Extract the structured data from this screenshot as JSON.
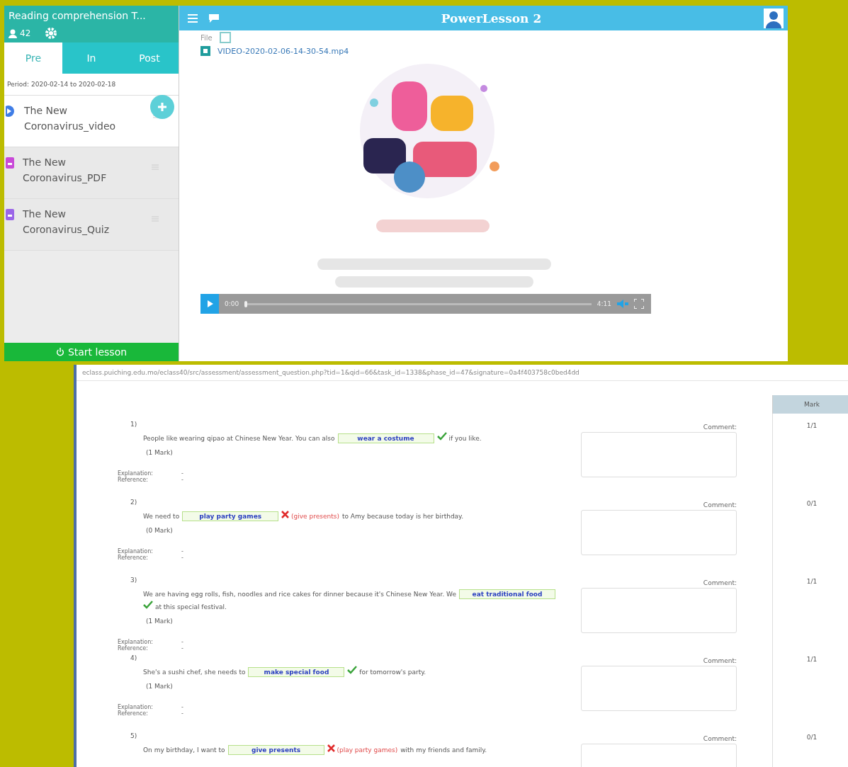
{
  "lesson_app": {
    "sidebar": {
      "title": "Reading comprehension T...",
      "students": "42",
      "tabs": [
        {
          "label": "Pre",
          "selected": true
        },
        {
          "label": "In",
          "selected": false
        },
        {
          "label": "Post",
          "selected": false
        }
      ],
      "period": "Period: 2020-02-14 to 2020-02-18",
      "items": [
        {
          "kind": "video",
          "title": "The New Coronavirus_video",
          "selected": true
        },
        {
          "kind": "pdf",
          "title": "The New Coronavirus_PDF",
          "selected": false
        },
        {
          "kind": "quiz",
          "title": "The New Coronavirus_Quiz",
          "selected": false
        }
      ],
      "start_button": "Start lesson"
    },
    "header": {
      "title": "PowerLesson 2"
    },
    "file_label": "File",
    "file_name": "VIDEO-2020-02-06-14-30-54.mp4",
    "player": {
      "current_time": "0:00",
      "duration": "4:11",
      "level": 0.0
    }
  },
  "assessment": {
    "url": "eclass.puiching.edu.mo/eclass40/src/assessment/assessment_question.php?tid=1&qid=66&task_id=1338&phase_id=47&signature=0a4f403758c0bed4dd",
    "mark_header": "Mark",
    "questions": [
      {
        "number": "1)",
        "before": "People like wearing qipao at Chinese New Year. You can also",
        "answer": "wear a costume",
        "correct": true,
        "after": "if you like.",
        "marks": "(1 Mark)",
        "explanation_label": "Explanation:",
        "explanation": "-",
        "reference_label": "Reference:",
        "reference": "-",
        "comment_label": "Comment:",
        "score": "1/1"
      },
      {
        "number": "2)",
        "before": "We need to",
        "answer": "play party games",
        "correct": false,
        "correct_answer": "(give presents)",
        "after": "to Amy because today is her birthday.",
        "marks": "(0 Mark)",
        "explanation_label": "Explanation:",
        "explanation": "-",
        "reference_label": "Reference:",
        "reference": "-",
        "comment_label": "Comment:",
        "score": "0/1"
      },
      {
        "number": "3)",
        "before": "We are having egg rolls, fish, noodles and rice cakes for dinner because it's Chinese New Year. We",
        "answer": "eat traditional food",
        "correct": true,
        "after": "at this special festival.",
        "marks": "(1 Mark)",
        "explanation_label": "Explanation:",
        "explanation": "-",
        "reference_label": "Reference:",
        "reference": "-",
        "comment_label": "Comment:",
        "score": "1/1"
      },
      {
        "number": "4)",
        "before": "She's a sushi chef, she needs to",
        "answer": "make special food",
        "correct": true,
        "after": "for tomorrow's party.",
        "marks": "(1 Mark)",
        "explanation_label": "Explanation:",
        "explanation": "-",
        "reference_label": "Reference:",
        "reference": "-",
        "comment_label": "Comment:",
        "score": "1/1"
      },
      {
        "number": "5)",
        "before": "On my birthday, I want to",
        "answer": "give presents",
        "correct": false,
        "correct_answer": "(play party games)",
        "after": "with my friends and family.",
        "comment_label": "Comment:",
        "score": "0/1"
      }
    ]
  }
}
